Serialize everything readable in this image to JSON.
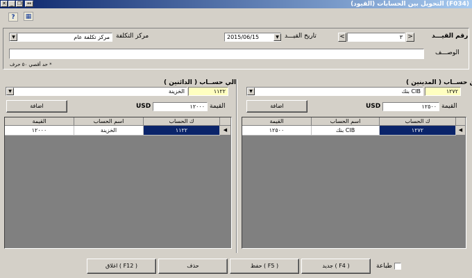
{
  "window": {
    "title": "(F034)  التحويل بين الحسابات (القيود)"
  },
  "header": {
    "entry_no_label": "رقم القيـــد",
    "entry_no_value": "٣",
    "entry_date_label": "تاريخ القيـــد",
    "entry_date_value": "2015/06/15",
    "cost_center_label": "مركز التكلفة",
    "cost_center_value": "مركز تكلفة عام",
    "description_label": "الوصـــف",
    "description_value": "",
    "max_chars_note": "* حد أقصي ٥٠ حرف"
  },
  "from_side": {
    "section_label": "من حســاب ( المدينين )",
    "account_code": "١٢٧٢",
    "account_name": "بنك CIB",
    "amount_label": "القيمة",
    "amount_value": "١٢٥٠٠",
    "currency": "USD",
    "add_button": "اضافة",
    "table": {
      "headers": [
        "القيمة",
        "اسم الحساب",
        "ك الحساب"
      ],
      "rows": [
        {
          "amount": "١٢٥٠٠",
          "name": "بنك CIB",
          "code": "١٢٧٢"
        }
      ]
    }
  },
  "to_side": {
    "section_label": "الي حســاب ( الدائنين )",
    "account_code": "١١٢٢",
    "account_name": "الخزينة",
    "amount_label": "القيمة",
    "amount_value": "١٢٠٠٠",
    "currency": "USD",
    "add_button": "اضافة",
    "table": {
      "headers": [
        "القيمة",
        "اسم الحساب",
        "ك الحساب"
      ],
      "rows": [
        {
          "amount": "١٢٠٠٠",
          "name": "الخزينة",
          "code": "١١٢٢"
        }
      ]
    }
  },
  "footer": {
    "print_label": "طباعة",
    "new_button": "جديد ( F4 )",
    "save_button": "حفظ ( F5 )",
    "delete_button": "حذف",
    "close_button": "اغلاق ( F12 )"
  },
  "colors": {
    "title_bar": "#0a246a",
    "selected_cell": "#0a246a",
    "highlight_field": "#ffffc0",
    "grid_background": "#808080"
  }
}
